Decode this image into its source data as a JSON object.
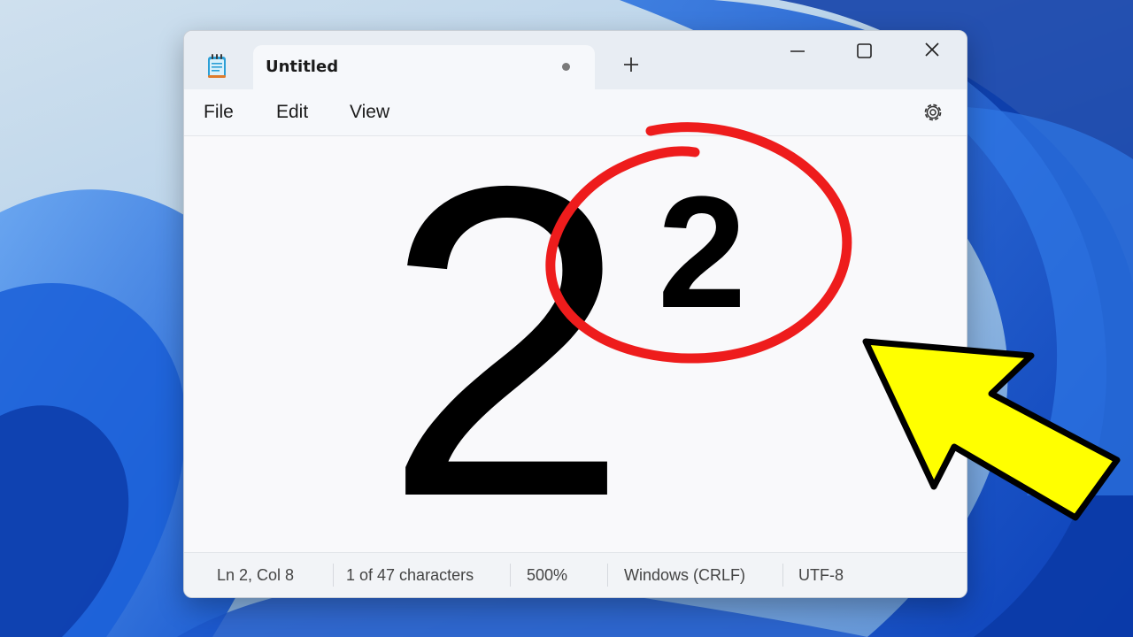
{
  "window": {
    "tab_title": "Untitled"
  },
  "menu": {
    "file": "File",
    "edit": "Edit",
    "view": "View"
  },
  "editor": {
    "base_text": "2",
    "superscript_text": "2"
  },
  "status": {
    "position": "Ln 2, Col 8",
    "characters": "1 of 47 characters",
    "zoom": "500%",
    "line_ending": "Windows (CRLF)",
    "encoding": "UTF-8"
  },
  "icons": {
    "app": "notepad-icon",
    "new_tab": "plus-icon",
    "minimize": "minimize-icon",
    "maximize": "maximize-icon",
    "close": "close-icon",
    "settings": "gear-icon",
    "unsaved": "unsaved-dot-icon"
  },
  "colors": {
    "annotation_circle": "#ee1c1c",
    "annotation_arrow": "#ffff00"
  }
}
